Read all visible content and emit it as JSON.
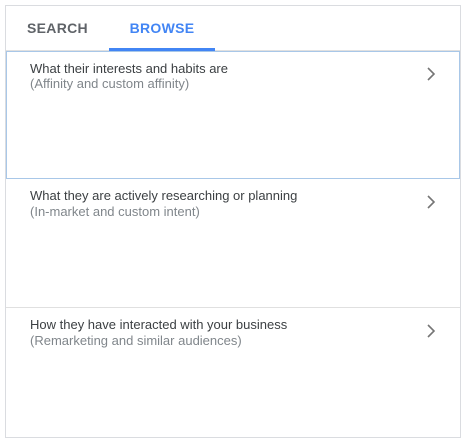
{
  "tabs": {
    "search_label": "SEARCH",
    "browse_label": "BROWSE",
    "active": "BROWSE"
  },
  "rows": [
    {
      "title": "What their interests and habits are",
      "subtitle": "(Affinity and custom affinity)",
      "icon": "chevron-right-icon"
    },
    {
      "title": "What they are actively researching or planning",
      "subtitle": "(In-market and custom intent)",
      "icon": "chevron-right-icon"
    },
    {
      "title": "How they have interacted with your business",
      "subtitle": "(Remarketing and similar audiences)",
      "icon": "chevron-right-icon"
    }
  ],
  "colors": {
    "accent": "#4285f4",
    "tab_inactive": "#5f6368",
    "title_text": "#3c4043",
    "subtitle_text": "#80868b",
    "divider": "#e0e0e0",
    "focus_border": "#a8c7e8"
  }
}
